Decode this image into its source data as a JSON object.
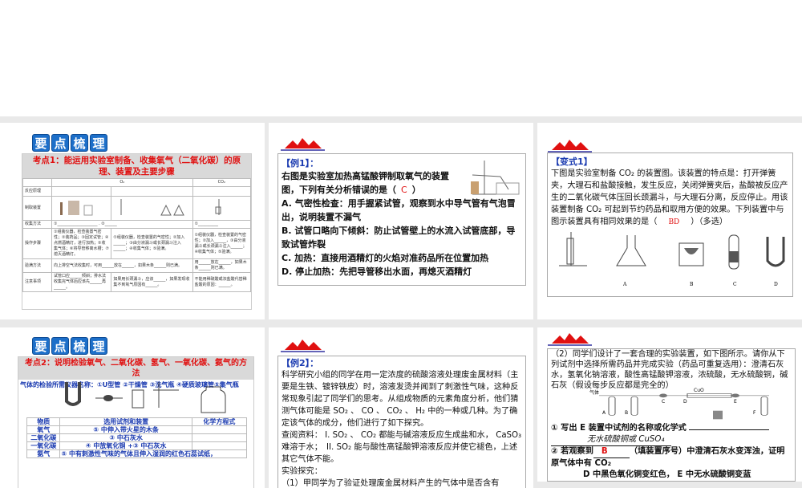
{
  "slide1": {
    "logo": [
      "要",
      "点",
      "梳",
      "理"
    ],
    "header": "考点1：能运用实验室制备、收集氧气（二氧化碳）的原理、装置及主要步骤",
    "cols": [
      "O₂",
      "CO₂"
    ],
    "rows": [
      {
        "label": "反应原理",
        "cells": [
          "",
          "",
          ""
        ]
      },
      {
        "label": "制取装置",
        "cells": [
          "",
          "",
          ""
        ]
      },
      {
        "label": "收集方法",
        "cells": [
          "①____________________ .",
          "②______",
          "①__________"
        ]
      },
      {
        "label": "操作步骤",
        "cells": [
          "①组装仪器，检查装置气密性；②装药品；③固定试管；④点燃酒精灯，进行加热；⑤收集气体；⑥将导管移离水槽；⑦熄灭酒精灯。",
          "①组装仪器，检查装置的气密性；②加入______；③由分液漏斗或长颈漏斗注入______；④收集气体；⑤验满。",
          "①组装仪器，检查装置的气密性；②加入______，③由分液漏斗或长颈漏斗注入______；④收集气体；⑤验满。"
        ]
      },
      {
        "label": "验满方法",
        "cells": [
          "向上排空气法收集时，可用______放在______，如果木条______则已满。",
          "",
          "用______放在______，如果木条______则已满。"
        ]
      },
      {
        "label": "注意事项",
        "cells": [
          "试管口应______倾斜；排水法收集完气体后应该先______再______。",
          "如果用长颈漏斗，应该______，如果发现收集不到氧气原因有______。",
          "不能用稀硫酸或浓盐酸代替稀盐酸的原因：______。"
        ]
      }
    ]
  },
  "slide2": {
    "title": "【例1】：",
    "question": "右图是实验室加热高锰酸钾制取氧气的装置图，下列有关分析错误的是（",
    "answer": "C",
    "question_end": "）",
    "options": [
      "A. 气密性检查：用手握紧试管，观察到水中导气管有气泡冒出，说明装置不漏气",
      "B. 试管口略向下倾斜：防止试管壁上的水流入试管底部，导致试管炸裂",
      "C. 加热：直接用酒精灯的火焰对准药品所在位置加热",
      "D. 停止加热：先把导管移出水面，再熄灭酒精灯"
    ]
  },
  "slide3": {
    "title": "【变式1】",
    "text": "下图是实验室制备 CO₂ 的装置图。该装置的特点是：打开弹簧夹，大理石和盐酸接触，发生反应，关闭弹簧夹后，盐酸被反应产生的二氧化碳气体压回长颈漏斗，与大理石分离，反应停止。用该装置制备 CO₂ 可起到节约药品和取用方便的效果。下列装置中与图示装置具有相同效果的是（",
    "answer": "BD",
    "text_end": "）（多选）",
    "figure_labels": [
      "A",
      "B",
      "C",
      "D"
    ]
  },
  "slide4": {
    "logo": [
      "要",
      "点",
      "梳",
      "理"
    ],
    "header": "考点2：说明检验氧气、二氧化碳、氢气、一氧化碳、氨气的方法",
    "instruments": "气体的检验所需仪器名称：①U型管 ②干燥管 ③洗气瓶 ④硬质玻璃管⑤集气瓶",
    "table_head": [
      "物质",
      "选用试剂和装置",
      "化学方程式"
    ],
    "table_rows": [
      [
        "氧气",
        "⑤ 中伸入带火星的木条",
        ""
      ],
      [
        "二氧化碳",
        "③ 中石灰水",
        ""
      ],
      [
        "一氧化碳",
        "④ 中放氧化铜 +③ 中石灰水",
        ""
      ],
      [
        "氨气",
        "⑤ 中有刺激性气味的气体且伸入湿润的红色石蕊试纸，",
        ""
      ]
    ]
  },
  "slide5": {
    "title": "【例2】：",
    "paragraphs": [
      "科学研究小组的同学在用一定浓度的硫酸溶液处理废金属材料（主要是生铁、镀锌铁皮）时，溶液发烫并闻到了刺激性气味，这种反常现象引起了同学们的思考。从组成物质的元素角度分析，他们猜测气体可能是 SO₂ 、 CO 、 CO₂ 、 H₂ 中的一种或几种。为了确定该气体的成分，他们进行了如下探究。",
      "查阅资料： I. SO₂ 、 CO₂ 都能与碱溶液反应生成盐和水， CaSO₃ 难溶于水；　II. SO₂ 能与酸性高锰酸钾溶液反应并使它褪色，上述其它气体不能。",
      "实验探究：",
      "（1）甲同学为了验证处理废金属材料产生的气体中是否含有"
    ]
  },
  "slide6": {
    "intro": "（2）同学们设计了一套合理的实验装置，如下图所示。请你从下列试剂中选择所需药品并完成实验（药品可重复选用）：澄清石灰水，氢氧化钠溶液，酸性高锰酸钾溶液，浓硫酸，无水硫酸铜，碱石灰（假设每步反应都是完全的）",
    "figure_labels": [
      "气体",
      "A",
      "B",
      "C",
      "D",
      "E",
      "F",
      "CuO"
    ],
    "q1": "① 写出 E 装置中试剂的名称或化学式",
    "a1": "无水硫酸铜或 CuSO₄",
    "q2a": "② 若观察到",
    "a2": "B",
    "q2b": "（填装置序号）中澄清石灰水变浑浊，证明原气体中有 CO₂",
    "a3": "D 中黑色氧化铜变红色， E 中无水硫酸铜变蓝"
  }
}
